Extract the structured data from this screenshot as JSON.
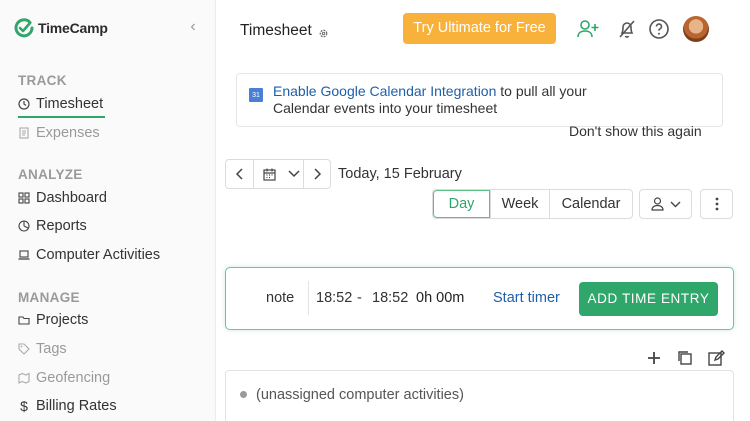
{
  "app": {
    "name": "TimeCamp",
    "brand_color": "#2fa66a",
    "accent_color": "#f8b13a"
  },
  "sidebar": {
    "collapse_icon": "chevron-left-icon",
    "sections": [
      {
        "title": "TRACK",
        "items": [
          {
            "label": "Timesheet",
            "icon": "clock-icon",
            "active": true
          },
          {
            "label": "Expenses",
            "icon": "receipt-icon",
            "muted": true
          }
        ]
      },
      {
        "title": "ANALYZE",
        "items": [
          {
            "label": "Dashboard",
            "icon": "dashboard-icon"
          },
          {
            "label": "Reports",
            "icon": "pie-chart-icon"
          },
          {
            "label": "Computer Activities",
            "icon": "laptop-icon"
          }
        ]
      },
      {
        "title": "MANAGE",
        "items": [
          {
            "label": "Projects",
            "icon": "folder-icon"
          },
          {
            "label": "Tags",
            "icon": "tag-icon",
            "muted": true
          },
          {
            "label": "Geofencing",
            "icon": "map-icon",
            "muted": true
          },
          {
            "label": "Billing Rates",
            "icon": "dollar-icon"
          }
        ]
      }
    ]
  },
  "header": {
    "title": "Timesheet",
    "upgrade_label": "Try Ultimate for Free",
    "icons": [
      "add-user-icon",
      "bell-off-icon",
      "help-icon",
      "avatar"
    ]
  },
  "banner": {
    "link_text": "Enable Google Calendar Integration",
    "rest_text": " to pull all your Calendar events into your timesheet",
    "dismiss_label": "Don't show this again",
    "calendar_badge": "31"
  },
  "date_controls": {
    "date_label": "Today, 15 February",
    "views": [
      "Day",
      "Week",
      "Calendar"
    ],
    "active_view": "Day"
  },
  "entry": {
    "note_label": "note",
    "start_time": "18:52",
    "separator": "-",
    "end_time": "18:52",
    "duration": "0h 00m",
    "start_timer_label": "Start timer",
    "add_entry_label": "ADD TIME ENTRY"
  },
  "list": {
    "items": [
      {
        "label": "(unassigned computer activities)"
      }
    ]
  }
}
